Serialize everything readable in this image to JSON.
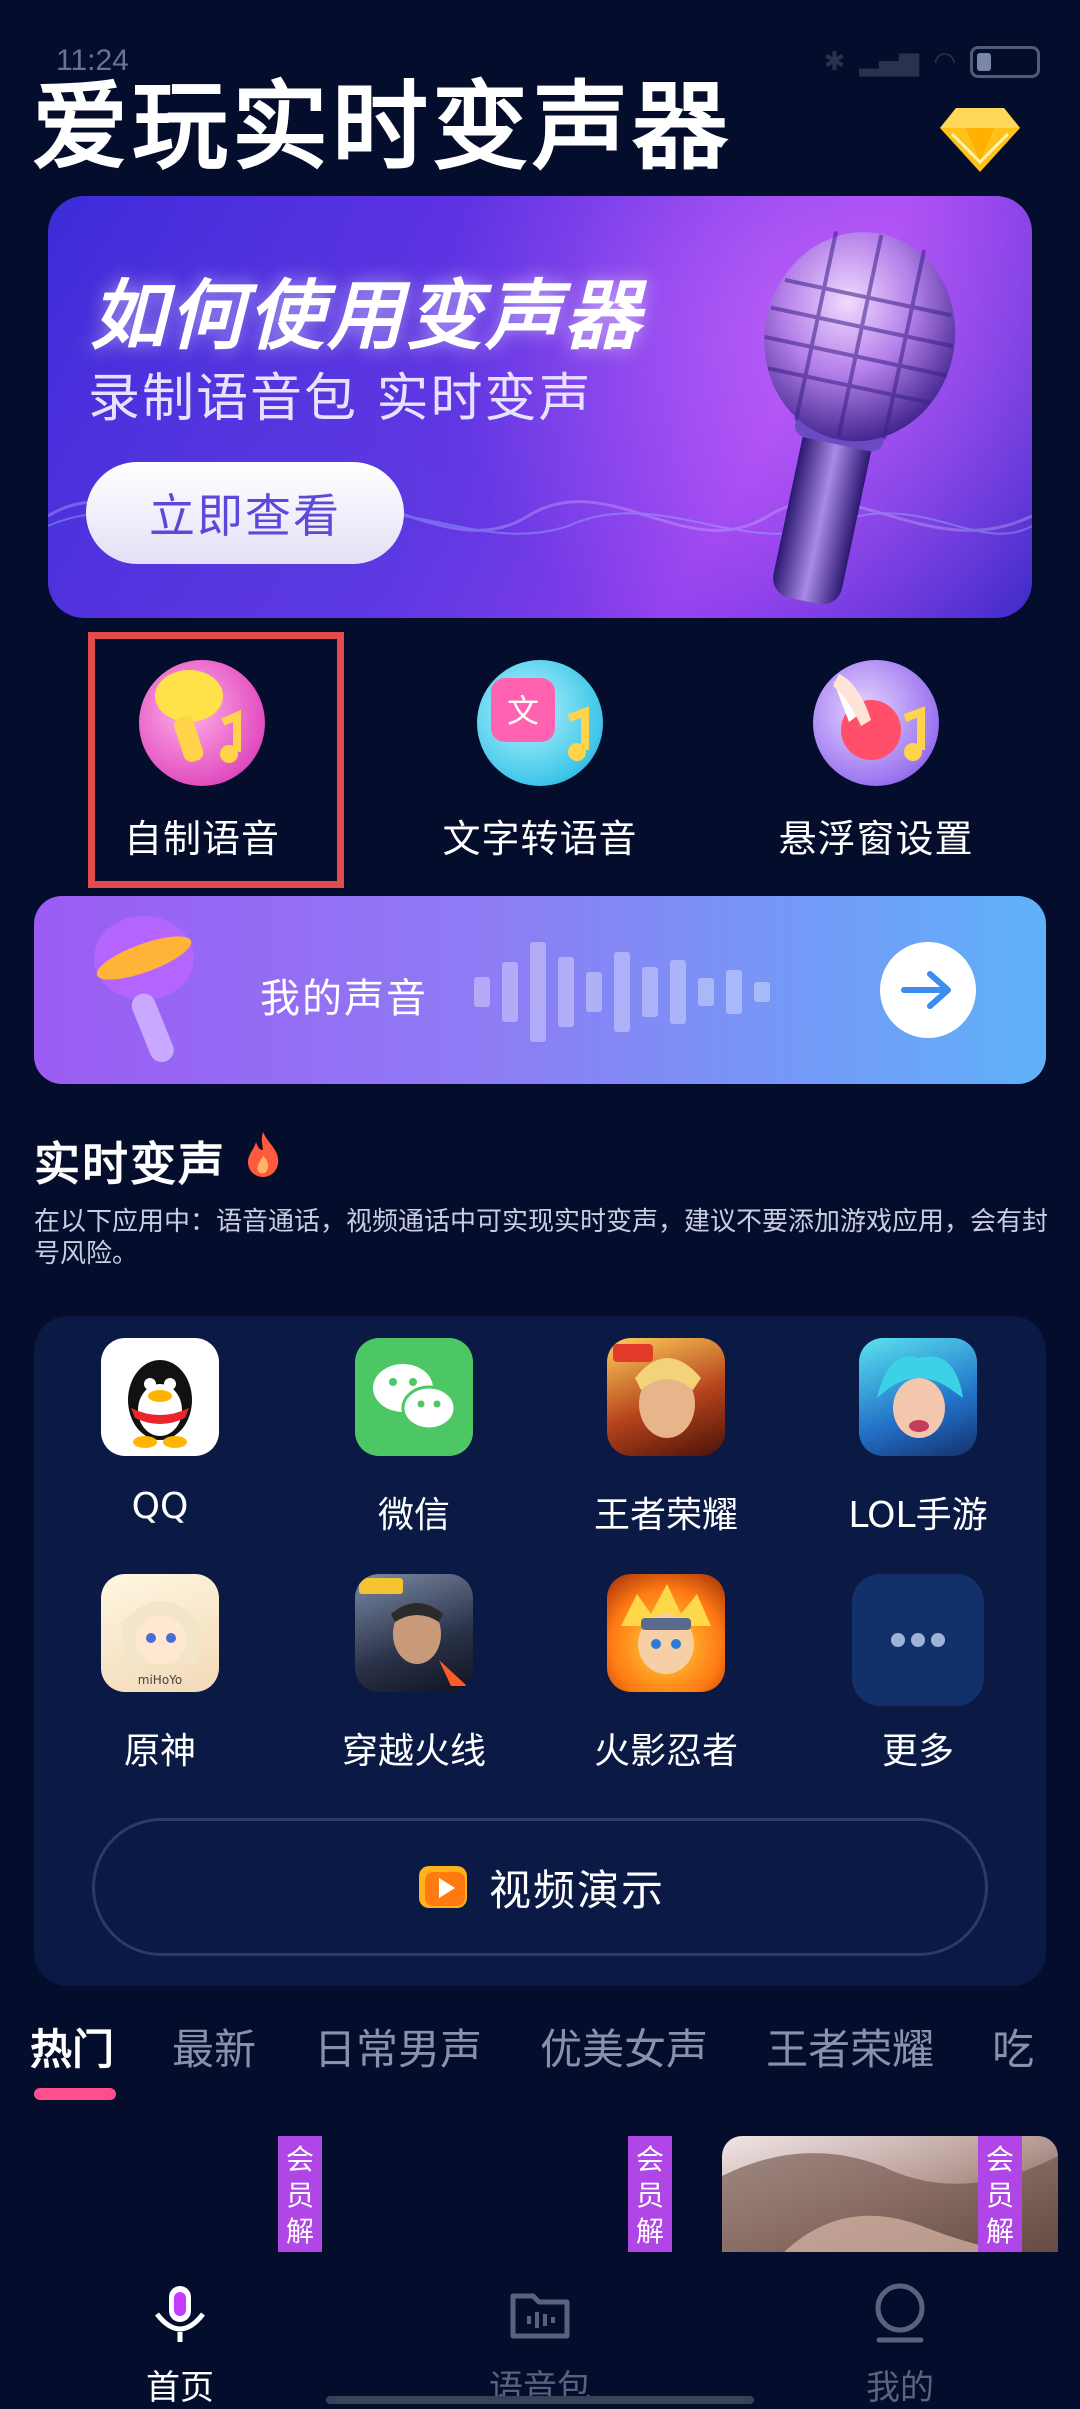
{
  "status_bar": {
    "time": "11:24",
    "icons": [
      "bluetooth-icon",
      "signal-icon",
      "wifi-icon",
      "battery-icon"
    ]
  },
  "header": {
    "title": "爱玩实时变声器",
    "vip_icon": "diamond-icon"
  },
  "banner": {
    "title": "如何使用变声器",
    "subtitle": "录制语音包 实时变声",
    "button_label": "立即查看"
  },
  "features": [
    {
      "label": "自制语音",
      "icon": "microphone-music-icon"
    },
    {
      "label": "文字转语音",
      "icon": "text-to-speech-icon"
    },
    {
      "label": "悬浮窗设置",
      "icon": "tap-hand-icon"
    }
  ],
  "my_voice": {
    "label": "我的声音"
  },
  "realtime": {
    "title": "实时变声",
    "description": "在以下应用中：语音通话，视频通话中可实现实时变声，建议不要添加游戏应用，会有封号风险。"
  },
  "apps": [
    {
      "label": "QQ"
    },
    {
      "label": "微信"
    },
    {
      "label": "王者荣耀"
    },
    {
      "label": "LOL手游"
    },
    {
      "label": "原神"
    },
    {
      "label": "穿越火线"
    },
    {
      "label": "火影忍者"
    },
    {
      "label": "更多"
    }
  ],
  "demo_button": {
    "label": "视频演示"
  },
  "tabs": [
    "热门",
    "最新",
    "日常男声",
    "优美女声",
    "王者荣耀",
    "吃"
  ],
  "vip_tag": "会员解",
  "bottom_nav": [
    {
      "label": "首页",
      "active": true
    },
    {
      "label": "语音包",
      "active": false
    },
    {
      "label": "我的",
      "active": false
    }
  ],
  "colors": {
    "background": "#050d2c",
    "highlight": "#e24c4c",
    "tab_indicator": "#ff4d8d",
    "vip_tag": "#b046e6"
  }
}
